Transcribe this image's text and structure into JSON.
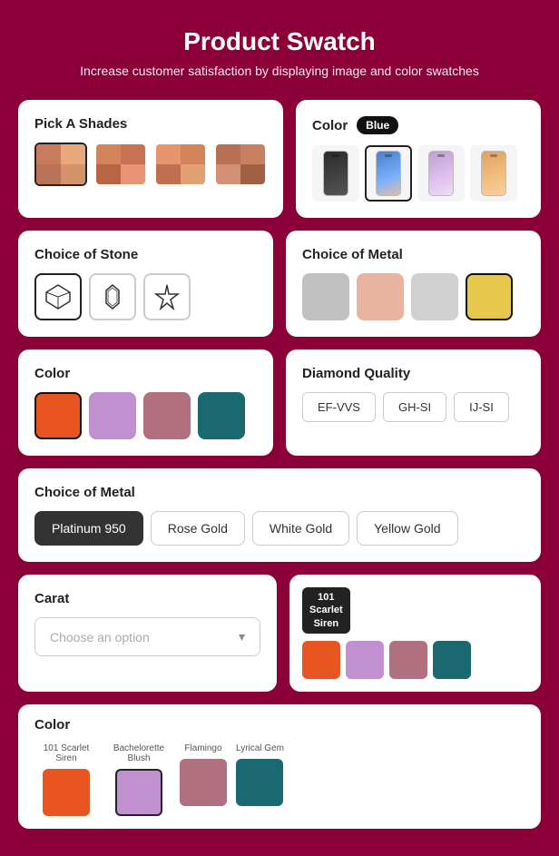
{
  "page": {
    "title": "Product Swatch",
    "subtitle": "Increase customer satisfaction by displaying image and color swatches"
  },
  "shades": {
    "label": "Pick A Shades",
    "swatches": [
      {
        "id": "shade1",
        "selected": true,
        "colors": [
          "#c97c5d",
          "#e8a87c",
          "#b87358",
          "#d4936a"
        ]
      },
      {
        "id": "shade2",
        "selected": false,
        "colors": [
          "#d4845a",
          "#c97355",
          "#b86545",
          "#e89575"
        ]
      },
      {
        "id": "shade3",
        "selected": false,
        "colors": [
          "#e8956d",
          "#d4845a",
          "#c07050",
          "#e0a070"
        ]
      },
      {
        "id": "shade4",
        "selected": false,
        "colors": [
          "#b87055",
          "#c88060",
          "#d49075",
          "#a06045"
        ]
      }
    ]
  },
  "colorPhone": {
    "label": "Color",
    "badge": "Blue",
    "phones": [
      {
        "id": "p1",
        "selected": false,
        "color": "#2a2a2a"
      },
      {
        "id": "p2",
        "selected": true,
        "color": "#5b8fd9"
      },
      {
        "id": "p3",
        "selected": false,
        "color": "#c9a0dc"
      },
      {
        "id": "p4",
        "selected": false,
        "color": "#e8a070"
      }
    ]
  },
  "stone": {
    "label": "Choice of Stone",
    "options": [
      {
        "id": "s1",
        "selected": true,
        "shape": "diamond"
      },
      {
        "id": "s2",
        "selected": false,
        "shape": "hexdiamond"
      },
      {
        "id": "s3",
        "selected": false,
        "shape": "star"
      }
    ]
  },
  "metalSwatches": {
    "label": "Choice of Metal",
    "options": [
      {
        "id": "m1",
        "selected": false,
        "color": "#c0c0c0"
      },
      {
        "id": "m2",
        "selected": false,
        "color": "#e8b4a0"
      },
      {
        "id": "m3",
        "selected": false,
        "color": "#d0d0d0"
      },
      {
        "id": "m4",
        "selected": true,
        "color": "#e8c84a"
      }
    ]
  },
  "colorSwatches": {
    "label": "Color",
    "options": [
      {
        "id": "c1",
        "selected": true,
        "color": "#e85520"
      },
      {
        "id": "c2",
        "selected": false,
        "color": "#c090d0"
      },
      {
        "id": "c3",
        "selected": false,
        "color": "#b07080"
      },
      {
        "id": "c4",
        "selected": false,
        "color": "#1a6870"
      }
    ]
  },
  "diamond": {
    "label": "Diamond Quality",
    "options": [
      "EF-VVS",
      "GH-SI",
      "IJ-SI"
    ]
  },
  "metalButtons": {
    "label": "Choice of Metal",
    "options": [
      {
        "id": "mb1",
        "label": "Platinum 950",
        "selected": true
      },
      {
        "id": "mb2",
        "label": "Rose Gold",
        "selected": false
      },
      {
        "id": "mb3",
        "label": "White Gold",
        "selected": false
      },
      {
        "id": "mb4",
        "label": "Yellow Gold",
        "selected": false
      }
    ]
  },
  "carat": {
    "label": "Carat",
    "placeholder": "Choose an option"
  },
  "scarlet": {
    "badge_line1": "101",
    "badge_line2": "Scarlet",
    "badge_line3": "Siren",
    "swatches": [
      {
        "id": "sc1",
        "color": "#e85520"
      },
      {
        "id": "sc2",
        "color": "#c090d0"
      },
      {
        "id": "sc3",
        "color": "#b07080"
      },
      {
        "id": "sc4",
        "color": "#1a6870"
      }
    ]
  },
  "colorBottom": {
    "label": "Color",
    "options": [
      {
        "id": "cb1",
        "label": "101 Scarlet Siren",
        "selected": false,
        "color": "#e85520"
      },
      {
        "id": "cb2",
        "label": "Bachelorette Blush",
        "selected": true,
        "color": "#c090d0"
      },
      {
        "id": "cb3",
        "label": "Flamingo",
        "selected": false,
        "color": "#b07080"
      },
      {
        "id": "cb4",
        "label": "Lyrical Gem",
        "selected": false,
        "color": "#1a6870"
      }
    ]
  }
}
